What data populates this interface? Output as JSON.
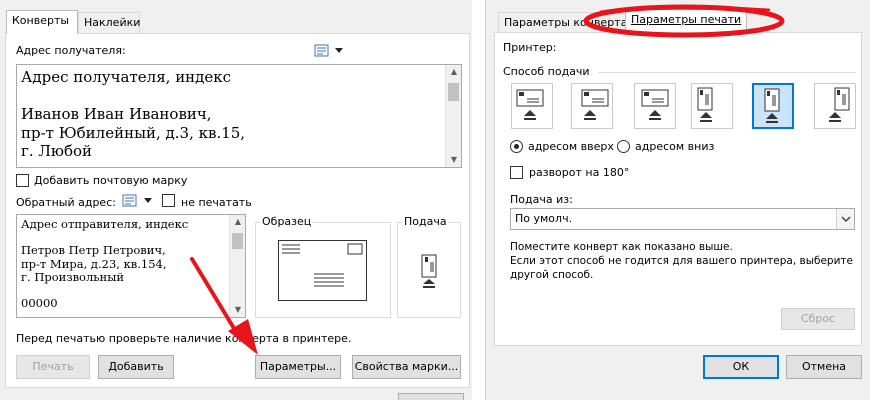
{
  "left": {
    "tabs": [
      "Конверты",
      "Наклейки"
    ],
    "recipient_label": "Адрес получателя:",
    "recipient_lines": [
      "Адрес получателя, индекс",
      "",
      "Иванов Иван Иванович,",
      "пр-т Юбилейный, д.3, кв.15,",
      "г. Любой"
    ],
    "add_postage_label": "Добавить почтовую марку",
    "return_label": "Обратный адрес:",
    "omit_label": "не печатать",
    "return_lines": [
      "Адрес отправителя, индекс",
      "",
      "Петров Петр Петрович,",
      "пр-т Мира, д.23, кв.154,",
      "г. Произвольный",
      "",
      "00000"
    ],
    "preview_label": "Образец",
    "feed_label": "Подача",
    "hint": "Перед печатью проверьте наличие конверта в принтере.",
    "buttons": {
      "print": "Печать",
      "add": "Добавить",
      "options": "Параметры...",
      "postage_props": "Свойства марки..."
    }
  },
  "right": {
    "tabs": [
      "Параметры конверта",
      "Параметры печати"
    ],
    "printer_label": "Принтер:",
    "feed_method_label": "Способ подачи",
    "face_up": "адресом вверх",
    "face_down": "адресом вниз",
    "rotate": "разворот на 180°",
    "feed_from_label": "Подача из:",
    "feed_from_value": "По умолч.",
    "note_lines": [
      "Поместите конверт как показано выше.",
      "Если этот способ не годится для вашего принтера, выберите",
      "другой способ."
    ],
    "reset": "Сброс",
    "ok": "ОК",
    "cancel": "Отмена",
    "selected_feed_index": 4
  },
  "colors": {
    "accent": "#0078d7",
    "annotation": "#e8141c"
  },
  "icons": [
    "address-book-icon",
    "dropdown-arrow-icon",
    "envelope-preview-icon",
    "envelope-feed-icon",
    "annotation-arrow-icon",
    "annotation-ellipse-icon"
  ]
}
